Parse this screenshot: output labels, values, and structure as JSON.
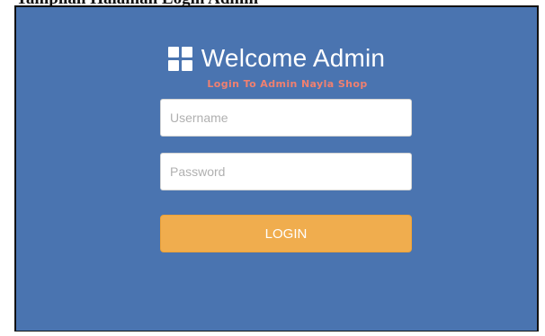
{
  "page": {
    "caption": "Tampilan Halaman Login Admin"
  },
  "login": {
    "title": "Welcome Admin",
    "subtitle": "Login To Admin Nayla Shop",
    "username_placeholder": "Username",
    "username_value": "",
    "password_placeholder": "Password",
    "password_value": "",
    "login_label": "LOGIN"
  },
  "icons": {
    "title_icon": "windows-grid-icon"
  },
  "colors": {
    "panel_background": "#4a74b0",
    "subtitle": "#f08070",
    "login_button": "#f0ad4e",
    "input_background": "#ffffff"
  }
}
